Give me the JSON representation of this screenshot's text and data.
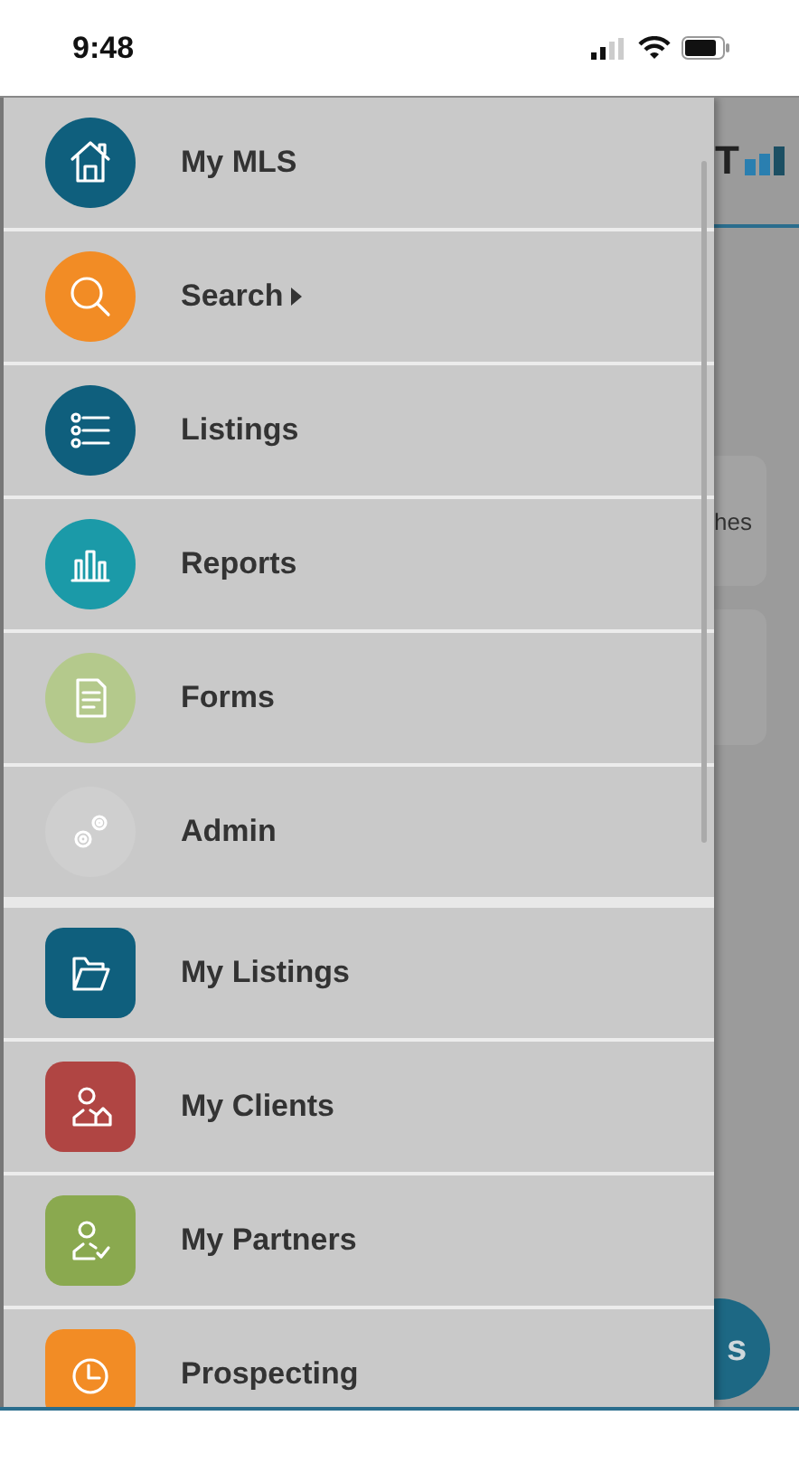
{
  "status_bar": {
    "time": "9:48"
  },
  "background_app": {
    "logo_text": "T",
    "card_text": "hes",
    "fab_text": "s"
  },
  "menu": {
    "sections": [
      {
        "kind": "circle",
        "items": [
          {
            "label": "My MLS",
            "color": "#0f5f7d",
            "has_submenu": false
          },
          {
            "label": "Search",
            "color": "#f28c25",
            "has_submenu": true
          },
          {
            "label": "Listings",
            "color": "#0f5f7d",
            "has_submenu": false
          },
          {
            "label": "Reports",
            "color": "#1b9aa8",
            "has_submenu": false
          },
          {
            "label": "Forms",
            "color": "#b4c98c",
            "has_submenu": false
          },
          {
            "label": "Admin",
            "color": "#cfcfcf",
            "has_submenu": false
          }
        ]
      },
      {
        "kind": "square",
        "items": [
          {
            "label": "My Listings",
            "color": "#0f5f7d",
            "has_submenu": false
          },
          {
            "label": "My Clients",
            "color": "#b04543",
            "has_submenu": false
          },
          {
            "label": "My Partners",
            "color": "#8aa94f",
            "has_submenu": false
          },
          {
            "label": "Prospecting",
            "color": "#f28c25",
            "has_submenu": false
          }
        ]
      }
    ]
  }
}
